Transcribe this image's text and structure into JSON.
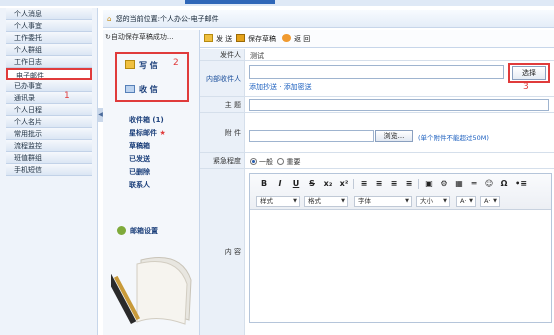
{
  "colors": {
    "accent": "#2f67b8",
    "highlight": "#e03b3b",
    "link": "#1b5fbf"
  },
  "leftnav": {
    "items": [
      {
        "label": "个人消息"
      },
      {
        "label": "个人事宜"
      },
      {
        "label": "工作委托"
      },
      {
        "label": "个人群组"
      },
      {
        "label": "工作日志"
      },
      {
        "label": "电子邮件"
      },
      {
        "label": "已办事宜"
      },
      {
        "label": "通讯录"
      },
      {
        "label": "个人日程"
      },
      {
        "label": "个人名片"
      },
      {
        "label": "常用批示"
      },
      {
        "label": "流程监控"
      },
      {
        "label": "班值群组"
      },
      {
        "label": "手机短信"
      }
    ],
    "selected_label": "电子邮件",
    "marker_1": "1"
  },
  "breadcrumb": {
    "text": "您的当前位置:个人办公-电子邮件"
  },
  "inner_sidebar": {
    "autosave_text": "自动保存草稿成功...",
    "compose_label": "写 信",
    "receive_label": "收 信",
    "marker_2": "2",
    "folders": [
      {
        "label": "收件箱 (1)"
      },
      {
        "label": "星标邮件"
      },
      {
        "label": "草稿箱"
      },
      {
        "label": "已发送"
      },
      {
        "label": "已删除"
      },
      {
        "label": "联系人"
      }
    ],
    "star_glyph": "★",
    "mail_settings_label": "邮箱设置"
  },
  "toolbar": {
    "send_label": "发 送",
    "save_draft_label": "保存草稿",
    "back_label": "返 回"
  },
  "form": {
    "sender_label": "发件人",
    "sender_value": "测试",
    "internal_recipient_label": "内部收件人",
    "select_button_label": "选择",
    "marker_3": "3",
    "add_cc_label": "添加抄送",
    "add_bcc_label": "添加密送",
    "subject_label": "主 题",
    "attachment_label": "附 件",
    "browse_label": "浏览...",
    "attachment_hint": "(单个附件不能超过50M)",
    "urgency_label": "紧急程度",
    "urgency_options": [
      {
        "label": "一般",
        "checked": true
      },
      {
        "label": "重要",
        "checked": false
      }
    ],
    "content_label": "内 容"
  },
  "editor": {
    "toolbar_buttons": [
      "B",
      "I",
      "U",
      "S",
      "x₂",
      "x²",
      "≡",
      "≡",
      "≡",
      "≡",
      "▣",
      "⚙",
      "▦",
      "═",
      "☺",
      "Ω",
      "•≡"
    ],
    "dropdowns": [
      {
        "label": "样式"
      },
      {
        "label": "格式"
      },
      {
        "label": "字体"
      },
      {
        "label": "大小"
      },
      {
        "label": "A·"
      },
      {
        "label": "A·"
      }
    ]
  }
}
